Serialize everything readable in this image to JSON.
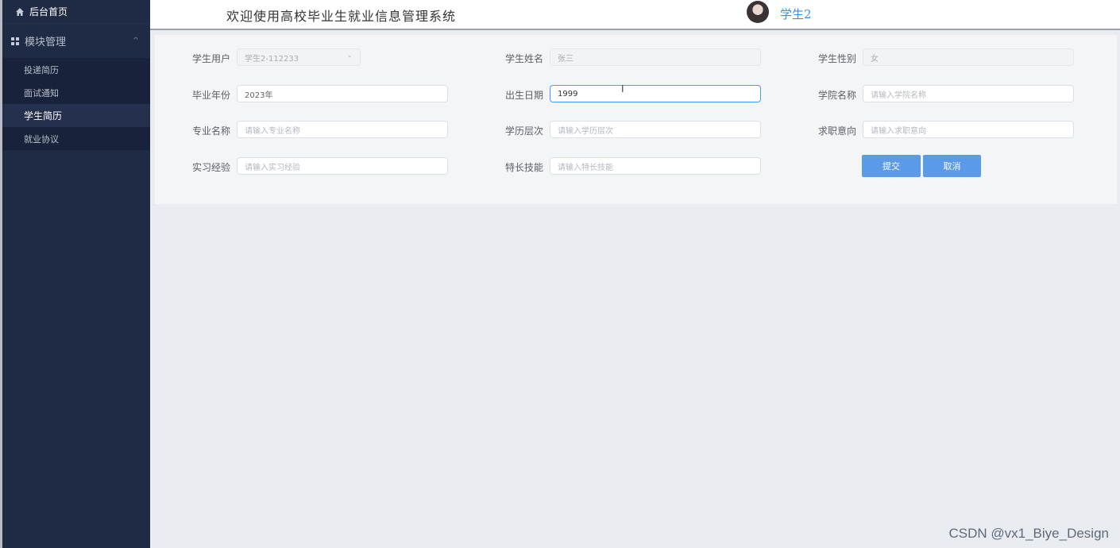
{
  "sidebar": {
    "home_label": "后台首页",
    "group_label": "模块管理",
    "items": [
      {
        "label": "投递简历"
      },
      {
        "label": "面试通知"
      },
      {
        "label": "学生简历"
      },
      {
        "label": "就业协议"
      }
    ]
  },
  "header": {
    "title": "欢迎使用高校毕业生就业信息管理系统",
    "username": "学生2"
  },
  "form": {
    "student_user": {
      "label": "学生用户",
      "value": "学生2-112233"
    },
    "student_name": {
      "label": "学生姓名",
      "value": "张三"
    },
    "student_gender": {
      "label": "学生性别",
      "value": "女"
    },
    "grad_year": {
      "label": "毕业年份",
      "value": "2023年"
    },
    "birth_date": {
      "label": "出生日期",
      "value": "1999"
    },
    "college_name": {
      "label": "学院名称",
      "placeholder": "请输入学院名称"
    },
    "major_name": {
      "label": "专业名称",
      "placeholder": "请输入专业名称"
    },
    "degree_level": {
      "label": "学历层次",
      "placeholder": "请输入学历层次"
    },
    "job_intention": {
      "label": "求职意向",
      "placeholder": "请输入求职意向"
    },
    "internship": {
      "label": "实习经验",
      "placeholder": "请输入实习经验"
    },
    "skills": {
      "label": "特长技能",
      "placeholder": "请输入特长技能"
    },
    "submit_label": "提交",
    "cancel_label": "取消"
  },
  "watermark": "CSDN @vx1_Biye_Design"
}
